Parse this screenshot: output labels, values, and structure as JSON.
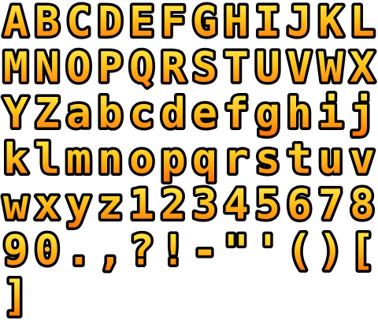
{
  "sprite_sheet": {
    "glyph_rows": [
      [
        "A",
        "B",
        "C",
        "D",
        "E",
        "F",
        "G",
        "H",
        "I",
        "J",
        "K",
        "L"
      ],
      [
        "M",
        "N",
        "O",
        "P",
        "Q",
        "R",
        "S",
        "T",
        "U",
        "V",
        "W",
        "X"
      ],
      [
        "Y",
        "Z",
        "a",
        "b",
        "c",
        "d",
        "e",
        "f",
        "g",
        "h",
        "i",
        "j"
      ],
      [
        "k",
        "l",
        "m",
        "n",
        "o",
        "p",
        "q",
        "r",
        "s",
        "t",
        "u",
        "v"
      ],
      [
        "w",
        "x",
        "y",
        "z",
        "1",
        "2",
        "3",
        "4",
        "5",
        "6",
        "7",
        "8"
      ],
      [
        "9",
        "0",
        ".",
        ",",
        "?",
        "!",
        "-",
        "\"",
        "'",
        "(",
        ")",
        "["
      ],
      [
        "]"
      ]
    ],
    "colors": {
      "gradient_top": "#fff45a",
      "gradient_mid": "#ffc21a",
      "gradient_bottom": "#ff6a0d",
      "outline": "#000000",
      "background": "#ffffff"
    }
  }
}
